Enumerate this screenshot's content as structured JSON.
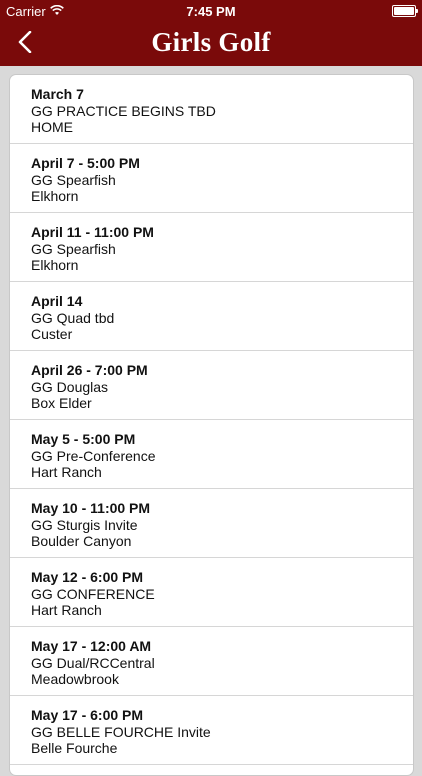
{
  "status": {
    "carrier": "Carrier",
    "time": "7:45 PM"
  },
  "nav": {
    "title": "Girls Golf"
  },
  "events": [
    {
      "date": "March 7",
      "event": "GG PRACTICE BEGINS TBD",
      "location": "HOME"
    },
    {
      "date": "April 7 - 5:00 PM",
      "event": "GG Spearfish",
      "location": "Elkhorn"
    },
    {
      "date": "April 11 - 11:00 PM",
      "event": "GG Spearfish",
      "location": "Elkhorn"
    },
    {
      "date": "April 14",
      "event": "GG Quad tbd",
      "location": "Custer"
    },
    {
      "date": "April 26 - 7:00 PM",
      "event": "GG Douglas",
      "location": "Box Elder"
    },
    {
      "date": "May 5 - 5:00 PM",
      "event": "GG Pre-Conference",
      "location": "Hart Ranch"
    },
    {
      "date": "May 10 - 11:00 PM",
      "event": "GG Sturgis Invite",
      "location": "Boulder Canyon"
    },
    {
      "date": "May 12 - 6:00 PM",
      "event": "GG CONFERENCE",
      "location": "Hart Ranch"
    },
    {
      "date": "May 17 - 12:00 AM",
      "event": "GG Dual/RCCentral",
      "location": "Meadowbrook"
    },
    {
      "date": "May 17 - 6:00 PM",
      "event": "GG BELLE FOURCHE Invite",
      "location": "Belle Fourche"
    }
  ]
}
